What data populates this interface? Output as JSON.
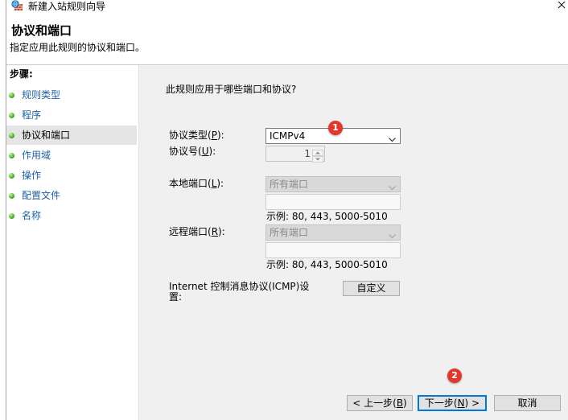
{
  "window": {
    "title": "新建入站规则向导",
    "icon": "firewall-wizard-icon",
    "close_icon": "close-icon"
  },
  "header": {
    "title": "协议和端口",
    "subtitle": "指定应用此规则的协议和端口。"
  },
  "steps": {
    "heading": "步骤:",
    "bullet_icon": "green-bullet-icon",
    "items": [
      {
        "label": "规则类型",
        "current": false
      },
      {
        "label": "程序",
        "current": false
      },
      {
        "label": "协议和端口",
        "current": true
      },
      {
        "label": "作用域",
        "current": false
      },
      {
        "label": "操作",
        "current": false
      },
      {
        "label": "配置文件",
        "current": false
      },
      {
        "label": "名称",
        "current": false
      }
    ]
  },
  "content": {
    "question": "此规则应用于哪些端口和协议?",
    "protocol_type": {
      "label": {
        "pre": "协议类型(",
        "key": "P",
        "post": "):"
      },
      "selected": "ICMPv4",
      "disabled": false
    },
    "protocol_number": {
      "label": {
        "pre": "协议号(",
        "key": "U",
        "post": "):"
      },
      "value": "1",
      "disabled": true
    },
    "local_port": {
      "label": {
        "pre": "本地端口(",
        "key": "L",
        "post": "):"
      },
      "selected": "所有端口",
      "text": "",
      "example": "示例: 80, 443, 5000-5010",
      "disabled": true
    },
    "remote_port": {
      "label": {
        "pre": "远程端口(",
        "key": "R",
        "post": "):"
      },
      "selected": "所有端口",
      "text": "",
      "example": "示例: 80, 443, 5000-5010",
      "disabled": true
    },
    "icmp_settings": {
      "label": "Internet 控制消息协议(ICMP)设置:",
      "button": "自定义"
    }
  },
  "footer": {
    "back": {
      "pre": "< 上一步(",
      "key": "B",
      "post": ")"
    },
    "next": {
      "pre": "下一步(",
      "key": "N",
      "post": ") >",
      "is_default": true
    },
    "cancel": "取消"
  },
  "annotations": [
    {
      "label": "1"
    },
    {
      "label": "2"
    }
  ],
  "colors": {
    "step_text": "#1f5fa6",
    "current_step_bg": "#e5e5e5",
    "badge": "#e2372c",
    "default_button_border": "#0078d7",
    "panel_bg": "#f0f0f0",
    "header_bg": "#ffffff"
  }
}
